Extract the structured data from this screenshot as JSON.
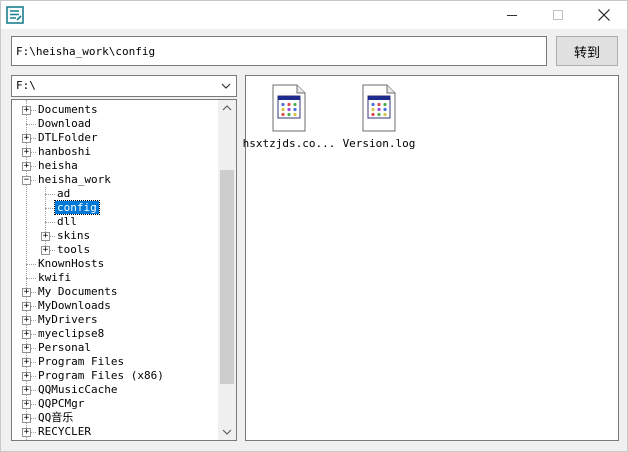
{
  "path_bar": {
    "value": "F:\\heisha_work\\config",
    "goto_label": "转到"
  },
  "drive": {
    "selected": "F:\\"
  },
  "tree": [
    {
      "label": "Documents",
      "level": 1,
      "expandable": true
    },
    {
      "label": "Download",
      "level": 1,
      "expandable": false
    },
    {
      "label": "DTLFolder",
      "level": 1,
      "expandable": true
    },
    {
      "label": "hanboshi",
      "level": 1,
      "expandable": true
    },
    {
      "label": "heisha",
      "level": 1,
      "expandable": true
    },
    {
      "label": "heisha_work",
      "level": 1,
      "expandable": true,
      "expanded": true
    },
    {
      "label": "ad",
      "level": 2,
      "expandable": false
    },
    {
      "label": "config",
      "level": 2,
      "expandable": false,
      "selected": true
    },
    {
      "label": "dll",
      "level": 2,
      "expandable": false
    },
    {
      "label": "skins",
      "level": 2,
      "expandable": true
    },
    {
      "label": "tools",
      "level": 2,
      "expandable": true
    },
    {
      "label": "KnownHosts",
      "level": 1,
      "expandable": false
    },
    {
      "label": "kwifi",
      "level": 1,
      "expandable": false
    },
    {
      "label": "My Documents",
      "level": 1,
      "expandable": true
    },
    {
      "label": "MyDownloads",
      "level": 1,
      "expandable": true
    },
    {
      "label": "MyDrivers",
      "level": 1,
      "expandable": true
    },
    {
      "label": "myeclipse8",
      "level": 1,
      "expandable": true
    },
    {
      "label": "Personal",
      "level": 1,
      "expandable": true
    },
    {
      "label": "Program Files",
      "level": 1,
      "expandable": true
    },
    {
      "label": "Program Files (x86)",
      "level": 1,
      "expandable": true
    },
    {
      "label": "QQMusicCache",
      "level": 1,
      "expandable": true
    },
    {
      "label": "QQPCMgr",
      "level": 1,
      "expandable": true
    },
    {
      "label": "QQ音乐",
      "level": 1,
      "expandable": true
    },
    {
      "label": "RECYCLER",
      "level": 1,
      "expandable": true
    }
  ],
  "files": [
    {
      "name": "hsxtzjds.co...",
      "icon": "config-file-icon"
    },
    {
      "name": "Version.log",
      "icon": "log-file-icon"
    }
  ],
  "colors": {
    "selection": "#0078d7",
    "window_bg": "#f0f0f0"
  }
}
